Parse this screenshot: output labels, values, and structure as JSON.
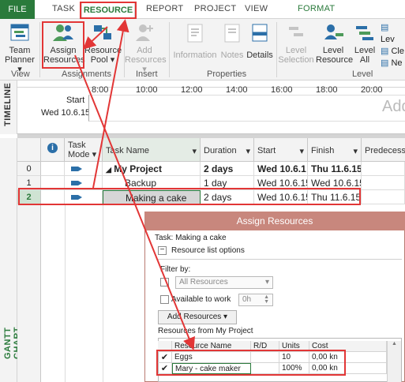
{
  "ribbon": {
    "tabs": {
      "file": "FILE",
      "task": "TASK",
      "resource": "RESOURCE",
      "report": "REPORT",
      "project": "PROJECT",
      "view": "VIEW",
      "format": "FORMAT"
    },
    "view_group": {
      "team_planner_line1": "Team",
      "team_planner_line2": "Planner",
      "label": "View"
    },
    "assignments_group": {
      "assign_line1": "Assign",
      "assign_line2": "Resources",
      "pool_line1": "Resource",
      "pool_line2": "Pool",
      "label": "Assignments"
    },
    "insert_group": {
      "add_line1": "Add",
      "add_line2": "Resources",
      "label": "Insert"
    },
    "properties_group": {
      "information": "Information",
      "notes": "Notes",
      "details": "Details",
      "label": "Properties"
    },
    "level_group": {
      "level_selection_line1": "Level",
      "level_selection_line2": "Selection",
      "level_resource_line1": "Level",
      "level_resource_line2": "Resource",
      "level_all_line1": "Level",
      "level_all_line2": "All",
      "label": "Level",
      "side1": "Lev",
      "side2": "Cle",
      "side3": "Ne"
    }
  },
  "timeline": {
    "side_label": "TIMELINE",
    "start_label": "Start",
    "start_date": "Wed 10.6.15",
    "ticks": [
      "8:00",
      "10:00",
      "12:00",
      "14:00",
      "16:00",
      "18:00",
      "20:00"
    ],
    "add_hint": "Add"
  },
  "gantt_side_label": "GANTT CHART",
  "grid": {
    "headers": {
      "mode_line1": "Task",
      "mode_line2": "Mode",
      "name": "Task Name",
      "duration": "Duration",
      "start": "Start",
      "finish": "Finish",
      "pred": "Predecesso"
    },
    "rows": [
      {
        "id": "0",
        "name": "My Project",
        "duration": "2 days",
        "start": "Wed 10.6.1",
        "finish": "Thu 11.6.15"
      },
      {
        "id": "1",
        "name": "Backup",
        "duration": "1 day",
        "start": "Wed 10.6.15",
        "finish": "Wed 10.6.15"
      },
      {
        "id": "2",
        "name": "Making a cake",
        "duration": "2 days",
        "start": "Wed 10.6.15",
        "finish": "Thu 11.6.15"
      }
    ],
    "summary_marker": "◢"
  },
  "dialog": {
    "title": "Assign Resources",
    "task_line": "Task: Making a cake",
    "options_label": "Resource list options",
    "filter_label": "Filter by:",
    "filter_value": "All Resources",
    "available_label": "Available to work",
    "available_value": "0h",
    "add_resources_button": "Add Resources",
    "resources_from": "Resources from My Project",
    "table_headers": {
      "name": "Resource Name",
      "rd": "R/D",
      "units": "Units",
      "cost": "Cost"
    },
    "rows": [
      {
        "name": "Eggs",
        "rd": "",
        "units": "10",
        "cost": "0,00 kn"
      },
      {
        "name": "Mary - cake maker",
        "rd": "",
        "units": "100%",
        "cost": "0,00 kn"
      }
    ]
  },
  "colors": {
    "accent": "#2a7a3b",
    "annotation": "#e23636",
    "dialog_title": "#c8877d"
  }
}
